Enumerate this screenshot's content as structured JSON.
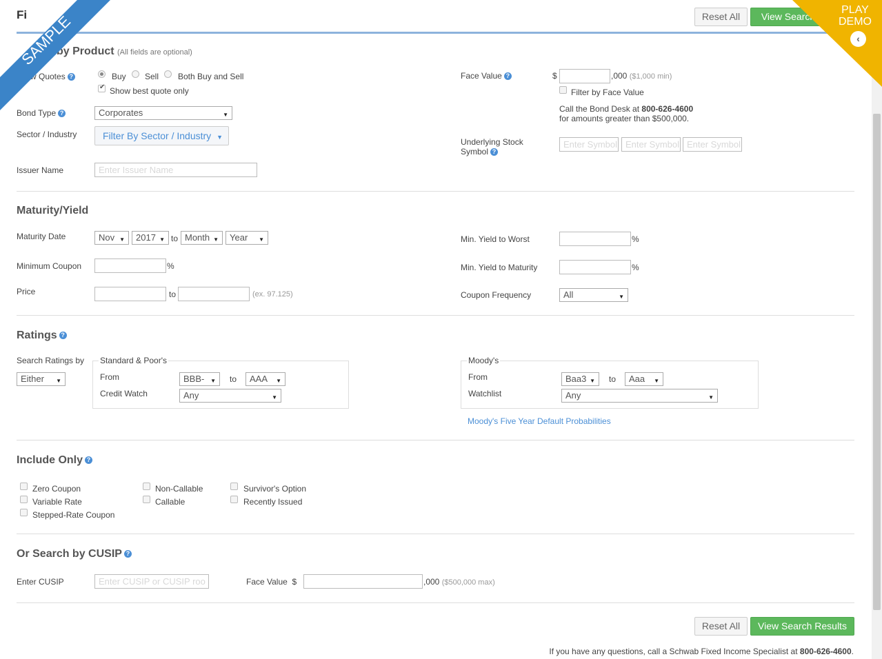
{
  "header": {
    "title_partial": "Fi",
    "reset_label": "Reset All",
    "view_label": "View Search"
  },
  "sample_ribbon": "SAMPLE",
  "demo_badge": {
    "label_line1": "PLAY",
    "label_line2": "DEMO"
  },
  "product": {
    "title": "by Product",
    "subtitle": "(All fields are optional)",
    "show_quotes_label": "w Quotes",
    "quote_options": [
      "Buy",
      "Sell",
      "Both Buy and Sell"
    ],
    "selected_quote": "Buy",
    "best_quote_label": "Show best quote only",
    "bond_type_label": "Bond Type",
    "bond_type_value": "Corporates",
    "sector_label": "Sector / Industry",
    "sector_button": "Filter By Sector / Industry",
    "issuer_label": "Issuer Name",
    "issuer_placeholder": "Enter Issuer Name",
    "face_value_label": "Face Value",
    "dollar": "$",
    "face_suffix": ",000",
    "face_min": "($1,000 min)",
    "filter_face_label": "Filter by Face Value",
    "call_text_1": "Call the Bond Desk at",
    "call_phone": "800-626-4600",
    "call_text_2": "for amounts greater than $500,000.",
    "underlying_label_1": "Underlying Stock",
    "underlying_label_2": "Symbol",
    "symbol_placeholder": "Enter Symbol"
  },
  "maturity": {
    "title": "Maturity/Yield",
    "maturity_date_label": "Maturity Date",
    "from_month": "Nov",
    "from_year": "2017",
    "to": "to",
    "to_month": "Month",
    "to_year": "Year",
    "min_coupon_label": "Minimum Coupon",
    "percent": "%",
    "price_label": "Price",
    "price_example": "(ex. 97.125)",
    "ytw_label": "Min. Yield to Worst",
    "ytm_label": "Min. Yield to Maturity",
    "coupon_freq_label": "Coupon Frequency",
    "coupon_freq_value": "All"
  },
  "ratings": {
    "title": "Ratings",
    "search_by_label": "Search Ratings by",
    "search_by_value": "Either",
    "sp_title": "Standard & Poor's",
    "from_label": "From",
    "sp_from": "BBB-",
    "to": "to",
    "sp_to": "AAA",
    "credit_watch_label": "Credit Watch",
    "credit_watch_value": "Any",
    "moodys_title": "Moody's",
    "m_from": "Baa3",
    "m_to": "Aaa",
    "watchlist_label": "Watchlist",
    "watchlist_value": "Any",
    "moodys_link": "Moody's Five Year Default Probabilities"
  },
  "include": {
    "title": "Include Only",
    "options": [
      "Zero Coupon",
      "Variable Rate",
      "Stepped-Rate Coupon",
      "Non-Callable",
      "Callable",
      "Survivor's Option",
      "Recently Issued"
    ]
  },
  "cusip": {
    "title": "Or Search by CUSIP",
    "enter_label": "Enter CUSIP",
    "placeholder": "Enter CUSIP or CUSIP roo",
    "face_label": "Face Value",
    "dollar": "$",
    "suffix": ",000",
    "max_note": "($500,000 max)"
  },
  "footer": {
    "reset_label": "Reset All",
    "view_label": "View Search Results",
    "question_text": "If you have any questions, call a Schwab Fixed Income Specialist at",
    "phone": "800-626-4600",
    "end": "."
  },
  "colors": {
    "accent": "#4b8fd6",
    "green": "#5cb85c",
    "ribbon": "#3b84c8",
    "demo": "#f0b400"
  }
}
